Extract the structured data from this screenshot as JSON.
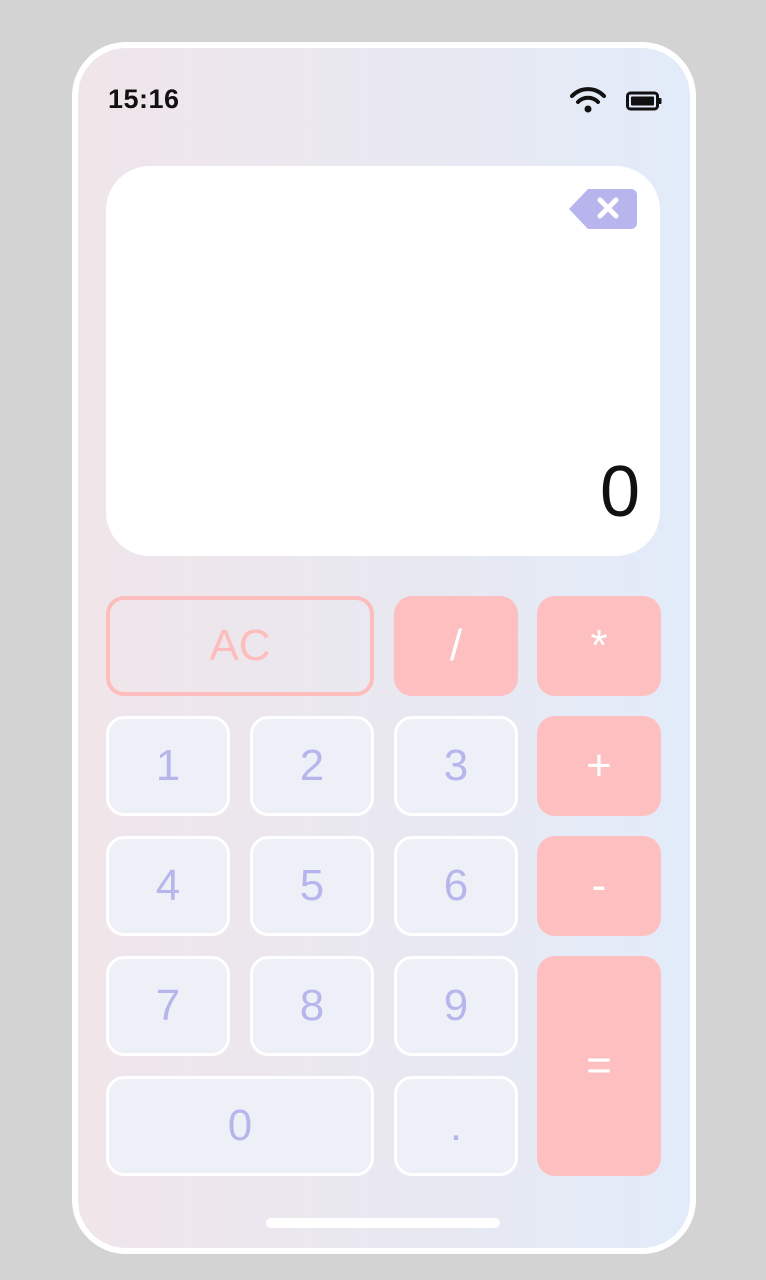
{
  "status_bar": {
    "time": "15:16",
    "wifi_icon": "wifi-icon",
    "battery_icon": "battery-icon"
  },
  "display": {
    "value": "0",
    "backspace_icon": "backspace-icon"
  },
  "keys": {
    "clear": "AC",
    "divide": "/",
    "multiply": "*",
    "one": "1",
    "two": "2",
    "three": "3",
    "plus": "+",
    "four": "4",
    "five": "5",
    "six": "6",
    "minus": "-",
    "seven": "7",
    "eight": "8",
    "nine": "9",
    "equals": "=",
    "zero": "0",
    "decimal": "."
  },
  "colors": {
    "operator_bg": "#fdbfbf",
    "digit_text": "#b7b6ec",
    "backspace": "#b8b5ee",
    "digit_bg": "#eef0f8"
  }
}
